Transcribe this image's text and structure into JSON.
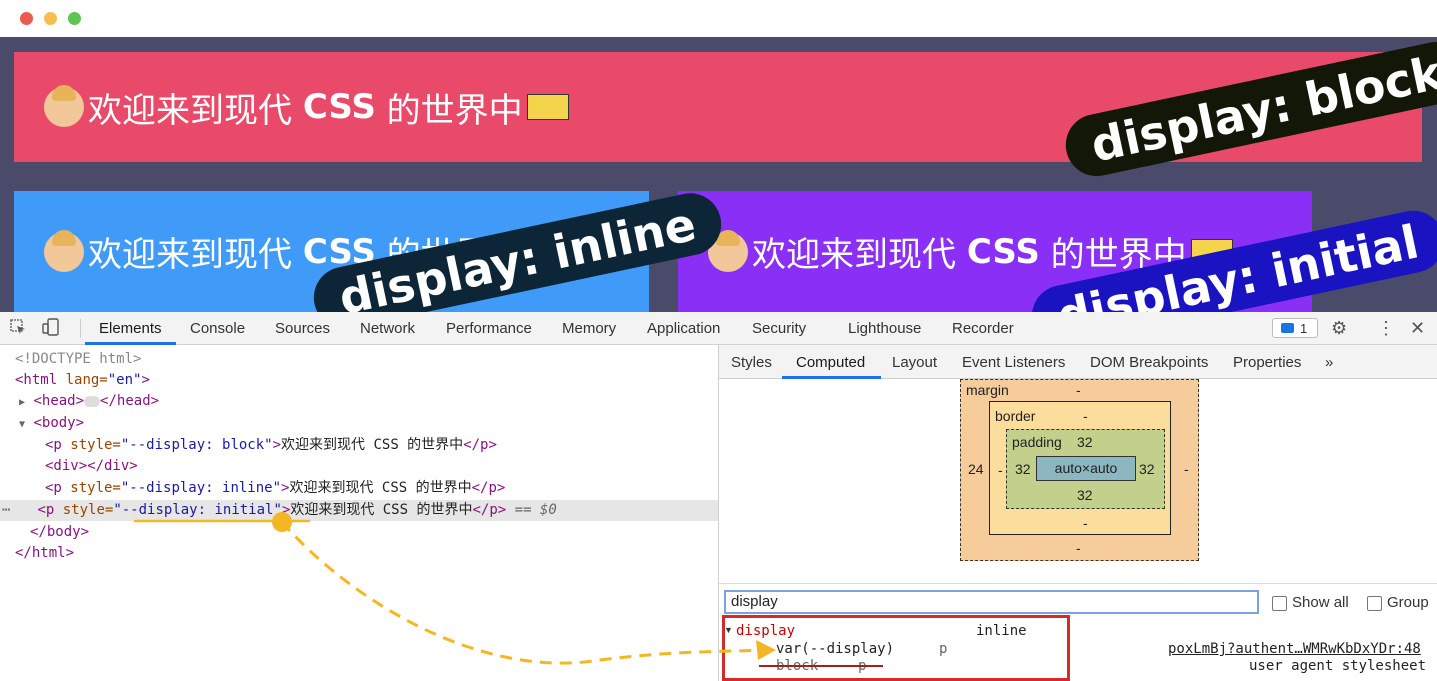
{
  "window": {
    "colors": {
      "close": "#ec5b52",
      "minimize": "#f5be4f",
      "maximize": "#5fc454"
    }
  },
  "preview": {
    "box_text_prefix": "欢迎来到现代",
    "box_text_css": "CSS",
    "box_text_suffix": "的世界中",
    "box1_color": "#e94a69",
    "box2_color": "#3f9bf7",
    "box3_color": "#8a2ff5",
    "badges": [
      {
        "label": "display: block",
        "color": "#121708"
      },
      {
        "label": "display: inline",
        "color": "#0c2537"
      },
      {
        "label": "display: initial",
        "color": "#1a13c2"
      }
    ]
  },
  "devtools": {
    "tabs": [
      "Elements",
      "Console",
      "Sources",
      "Network",
      "Performance",
      "Memory",
      "Application",
      "Security",
      "Lighthouse",
      "Recorder"
    ],
    "active_tab": "Elements",
    "issues_count": "1",
    "dom": {
      "doctype": "<!DOCTYPE html>",
      "html_open_tag": "<html",
      "html_lang_attr": " lang=",
      "html_lang_val": "\"en\"",
      "gt": ">",
      "head_open": "<head>",
      "head_close": "</head>",
      "body_open": "<body>",
      "p_open": "<p",
      "style_attr": " style=",
      "p1_style": "\"--display: block\"",
      "p2_style": "\"--display: inline\"",
      "p3_style": "\"--display: initial\"",
      "p_text": "欢迎来到现代 CSS 的世界中",
      "p_close": "</p>",
      "div_line": "<div></div>",
      "selected_suffix": "== $0",
      "body_close": "</body>",
      "html_close": "</html>"
    },
    "side_tabs": [
      "Styles",
      "Computed",
      "Layout",
      "Event Listeners",
      "DOM Breakpoints",
      "Properties"
    ],
    "active_side_tab": "Computed",
    "more_tabs": "»",
    "box_model": {
      "margin_label": "margin",
      "margin_top": "-",
      "margin_left": "24",
      "margin_right": "-",
      "margin_bottom": "-",
      "border_label": "border",
      "border_top": "-",
      "border_left": "-",
      "border_right": "-",
      "border_bottom": "-",
      "padding_label": "padding",
      "padding_top": "32",
      "padding_left": "32",
      "padding_right": "32",
      "padding_bottom": "32",
      "content": "auto×auto"
    },
    "filter_value": "display",
    "show_all_label": "Show all",
    "group_label": "Group",
    "computed": {
      "property": "display",
      "value": "inline",
      "rule1_value": "var(--display)",
      "rule1_selector": "p",
      "rule1_source": "poxLmBj?authent…WMRwKbDxYDr:48",
      "rule2_value": "block",
      "rule2_selector": "p",
      "rule2_source": "user agent stylesheet"
    }
  }
}
